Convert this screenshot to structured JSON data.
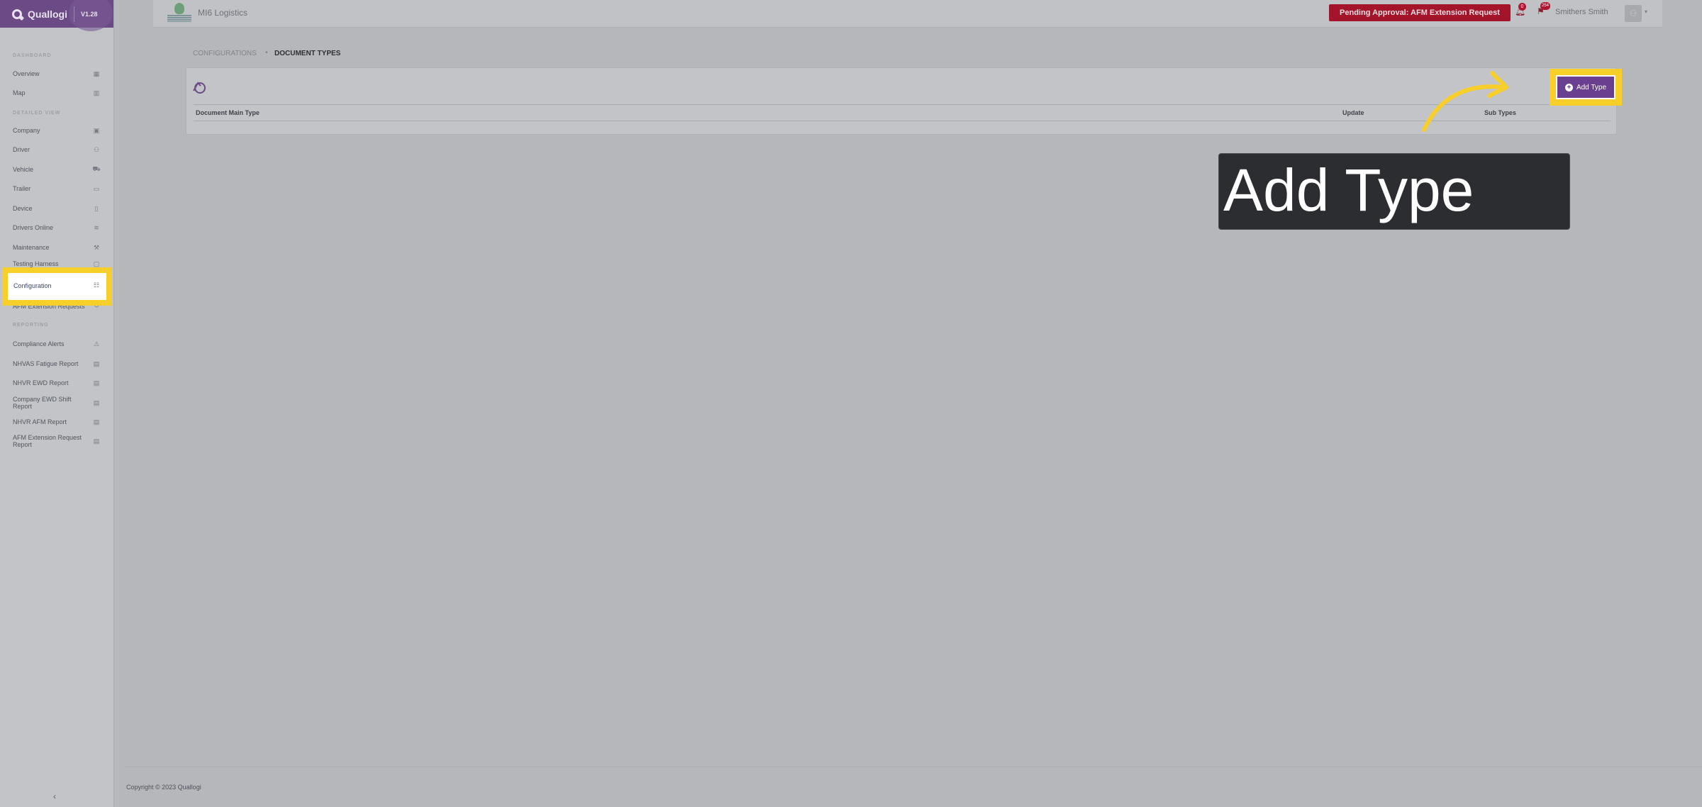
{
  "brand": {
    "name": "Quallogi",
    "version": "V1.28"
  },
  "sidebar": {
    "sections": [
      {
        "title": "DASHBOARD"
      },
      {
        "title": "DETAILED VIEW"
      },
      {
        "title": "REPORTING"
      }
    ],
    "items": [
      {
        "label": "Overview"
      },
      {
        "label": "Map"
      },
      {
        "label": "Company"
      },
      {
        "label": "Driver"
      },
      {
        "label": "Vehicle"
      },
      {
        "label": "Trailer"
      },
      {
        "label": "Device"
      },
      {
        "label": "Drivers Online"
      },
      {
        "label": "Maintenance"
      },
      {
        "label": "Testing Harness"
      },
      {
        "label": "Configuration"
      },
      {
        "label": "AFM Extension Requests"
      },
      {
        "label": "Compliance Alerts"
      },
      {
        "label": "NHVAS Fatigue Report"
      },
      {
        "label": "NHVR EWD Report"
      },
      {
        "label": "Company EWD Shift Report"
      },
      {
        "label": "NHVR AFM Report"
      },
      {
        "label": "AFM Extension Request Report"
      }
    ]
  },
  "topbar": {
    "company": "MI6 Logistics",
    "pending_button": "Pending Approval: AFM Extension Request",
    "notif_count": "0",
    "alert_count": "254",
    "user": "Smithers Smith"
  },
  "breadcrumb": {
    "parent": "CONFIGURATIONS",
    "current": "DOCUMENT TYPES"
  },
  "table": {
    "columns": [
      "Document Main Type",
      "Update",
      "Sub Types"
    ],
    "add_button": "Add Type"
  },
  "tooltip": {
    "text": "Add Type"
  },
  "footer": {
    "copyright": "Copyright © 2023 Quallogi"
  },
  "colors": {
    "brand": "#6b4a86",
    "highlight": "#f8cf2a",
    "pending": "#a4142b"
  }
}
